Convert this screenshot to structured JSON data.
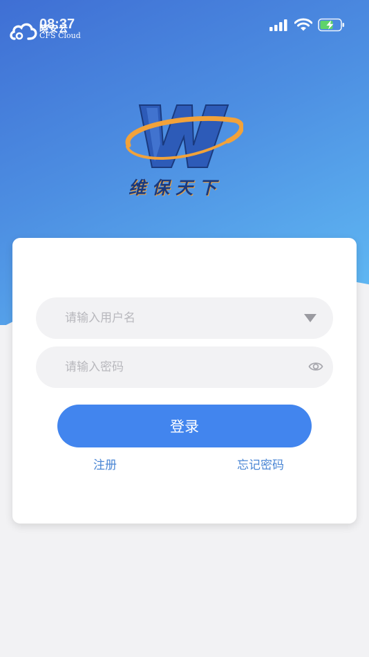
{
  "status_bar": {
    "brand_name": "晓安云",
    "brand_sub": "CFS Cloud",
    "time": "08:37",
    "icons": [
      "signal-icon",
      "wifi-icon",
      "battery-charging-icon"
    ]
  },
  "logo": {
    "letter": "W",
    "text": "维保天下"
  },
  "form": {
    "username_placeholder": "请输入用户名",
    "password_placeholder": "请输入密码",
    "username_value": "",
    "password_value": ""
  },
  "actions": {
    "login_label": "登录",
    "register_label": "注册",
    "forgot_label": "忘记密码"
  },
  "colors": {
    "accent": "#4285ee",
    "link": "#4a86d4",
    "hero_start": "#3f6fd4",
    "hero_end": "#62bdf5"
  }
}
